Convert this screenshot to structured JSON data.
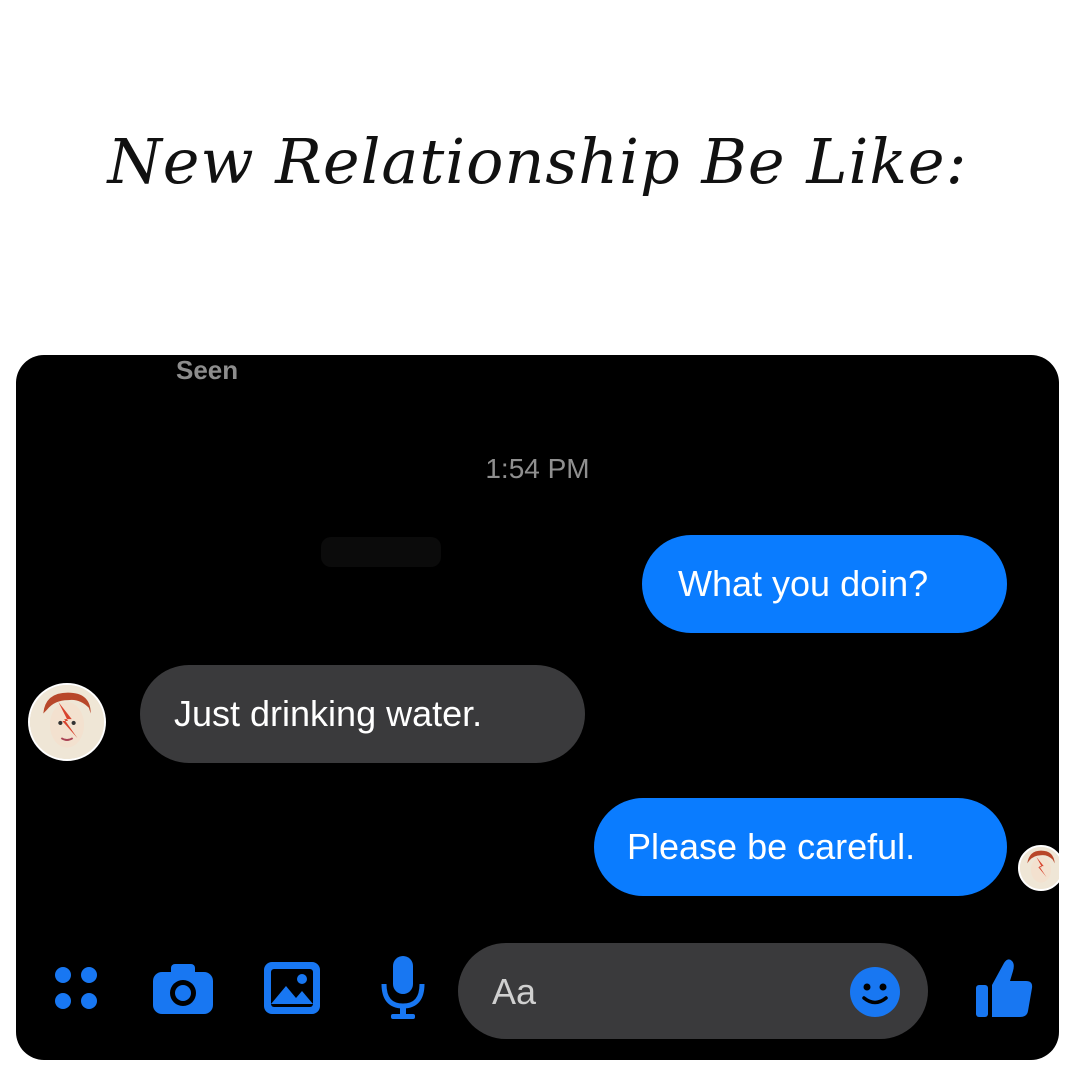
{
  "meme": {
    "title": "New Relationship Be Like:"
  },
  "chat": {
    "seen_label": "Seen",
    "timestamp": "1:54 PM",
    "messages": [
      {
        "from": "me",
        "text": "What you doin?"
      },
      {
        "from": "them",
        "text": "Just drinking water."
      },
      {
        "from": "me",
        "text": "Please be careful."
      }
    ]
  },
  "composer": {
    "placeholder": "Aa"
  },
  "toolbar": {
    "icons": [
      "apps-icon",
      "camera-icon",
      "gallery-icon",
      "microphone-icon",
      "emoji-icon",
      "thumbs-up-icon"
    ]
  },
  "colors": {
    "accent": "#0a7cff",
    "incoming_bubble": "#3a3a3c",
    "background": "#000000",
    "icon_blue": "#1877f2"
  }
}
